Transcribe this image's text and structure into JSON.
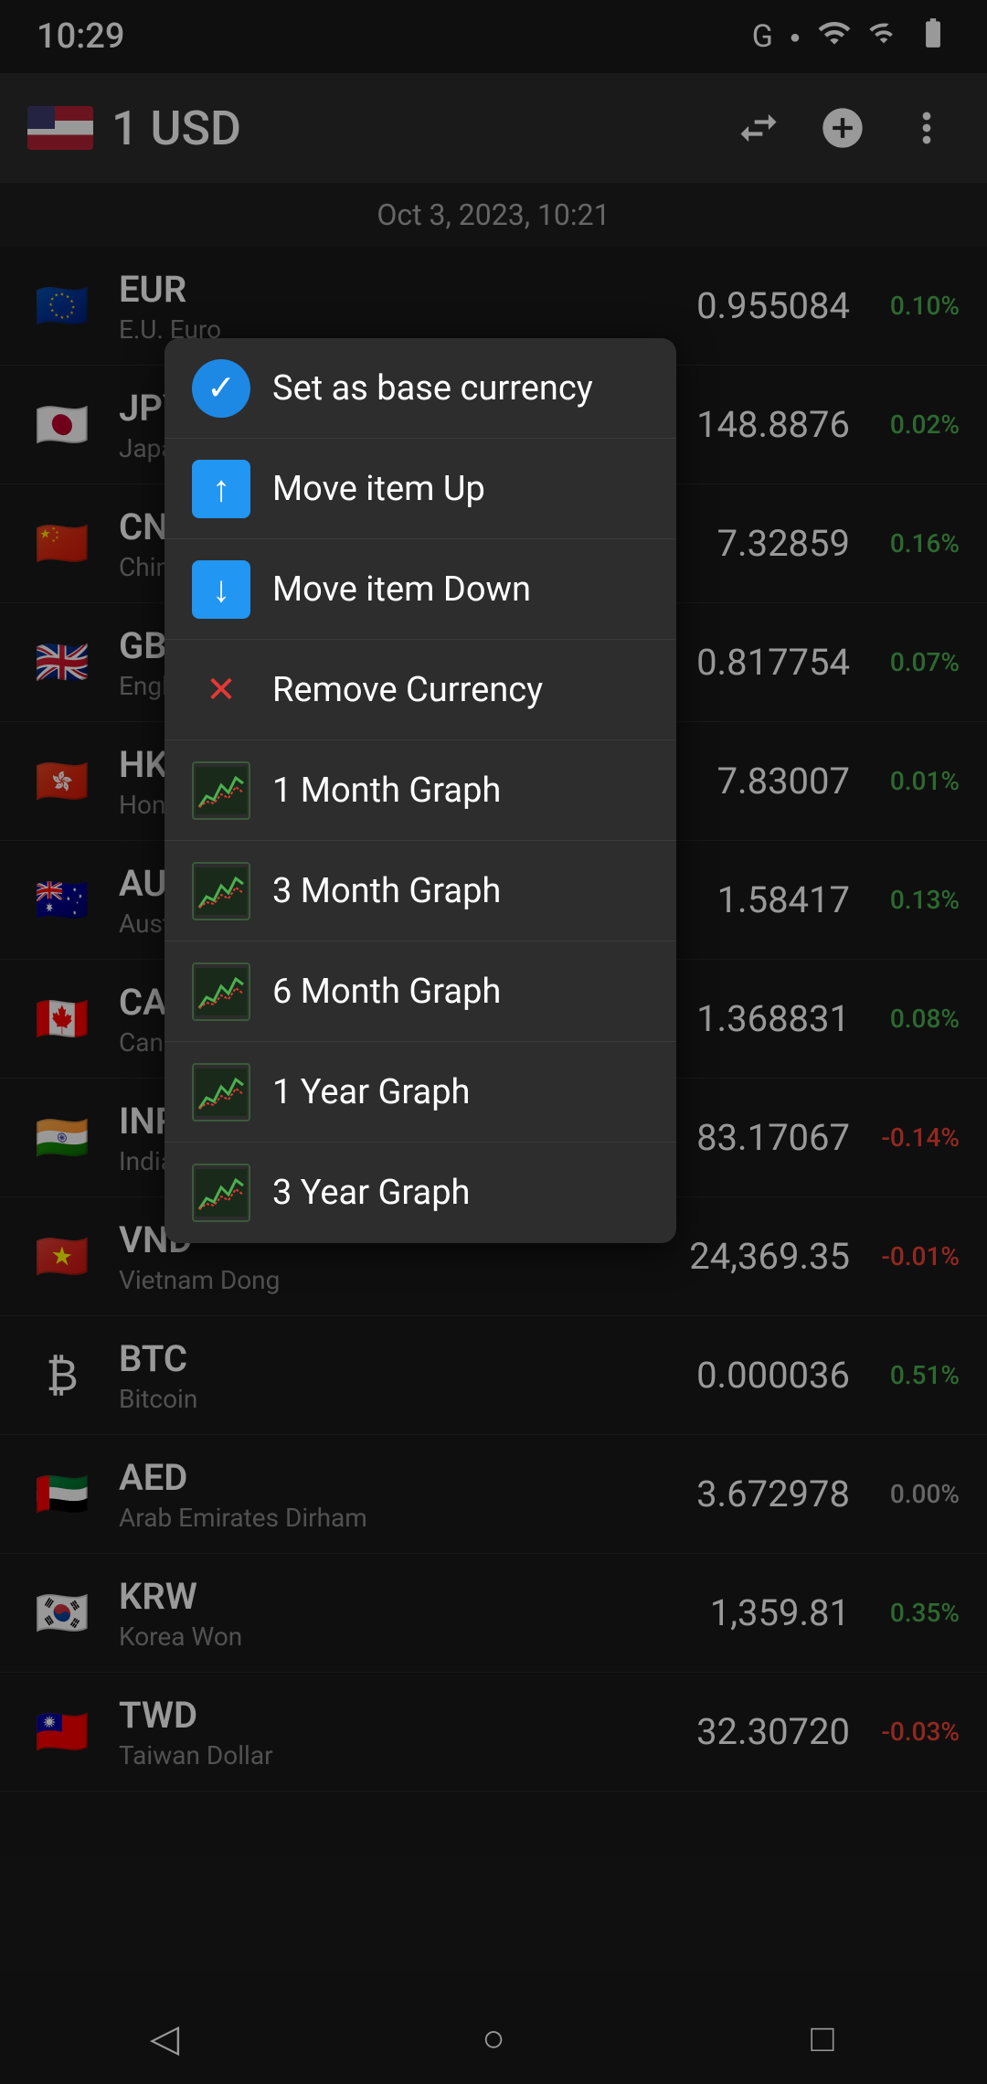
{
  "statusBar": {
    "time": "10:29",
    "icons": [
      "G",
      "signal",
      "wifi",
      "battery"
    ]
  },
  "toolbar": {
    "baseCurrency": "1 USD",
    "convertBtn": "→",
    "addBtn": "+",
    "moreBtn": "⋮"
  },
  "dateBar": {
    "text": "Oct 3, 2023, 10:21"
  },
  "currencies": [
    {
      "code": "EUR",
      "name": "E.U. Euro",
      "value": "0.955084",
      "change": "0.10%",
      "positive": true,
      "flag": "🇪🇺"
    },
    {
      "code": "JPY",
      "name": "Japanese Yen",
      "value": "148.8876",
      "change": "0.02%",
      "positive": true,
      "flag": "🇯🇵"
    },
    {
      "code": "CNY",
      "name": "Chinese Yuan",
      "value": "7.32859",
      "change": "0.16%",
      "positive": true,
      "flag": "🇨🇳"
    },
    {
      "code": "GBP",
      "name": "England Pound",
      "value": "0.817754",
      "change": "0.07%",
      "positive": true,
      "flag": "🇬🇧"
    },
    {
      "code": "HKD",
      "name": "Hong Kong Dollar",
      "value": "7.83007",
      "change": "0.01%",
      "positive": true,
      "flag": "🇭🇰"
    },
    {
      "code": "AUD",
      "name": "Australian Dollar",
      "value": "1.58417",
      "change": "0.13%",
      "positive": true,
      "flag": "🇦🇺"
    },
    {
      "code": "CAD",
      "name": "Canadian Dollar",
      "value": "1.368831",
      "change": "0.08%",
      "positive": true,
      "flag": "🇨🇦"
    },
    {
      "code": "INR",
      "name": "Indian Rupee",
      "value": "83.17067",
      "change": "-0.14%",
      "positive": false,
      "flag": "🇮🇳"
    },
    {
      "code": "VND",
      "name": "Vietnam Dong",
      "value": "24,369.35",
      "change": "-0.01%",
      "positive": false,
      "flag": "🇻🇳"
    },
    {
      "code": "BTC",
      "name": "Bitcoin",
      "value": "0.000036",
      "change": "0.51%",
      "positive": true,
      "flag": "₿"
    },
    {
      "code": "AED",
      "name": "Arab Emirates Dirham",
      "value": "3.672978",
      "change": "0.00%",
      "positive": null,
      "flag": "🇦🇪"
    },
    {
      "code": "KRW",
      "name": "Korea Won",
      "value": "1,359.81",
      "change": "0.35%",
      "positive": true,
      "flag": "🇰🇷"
    },
    {
      "code": "TWD",
      "name": "Taiwan Dollar",
      "value": "32.30720",
      "change": "-0.03%",
      "positive": false,
      "flag": "🇹🇼"
    }
  ],
  "contextMenu": {
    "items": [
      {
        "id": "set-base",
        "label": "Set as base currency",
        "icon": "✓",
        "iconType": "check"
      },
      {
        "id": "move-up",
        "label": "Move item Up",
        "icon": "↑",
        "iconType": "up"
      },
      {
        "id": "move-down",
        "label": "Move item Down",
        "icon": "↓",
        "iconType": "down"
      },
      {
        "id": "remove",
        "label": "Remove Currency",
        "icon": "✕",
        "iconType": "remove"
      },
      {
        "id": "1month",
        "label": "1 Month Graph",
        "icon": "graph",
        "iconType": "graph"
      },
      {
        "id": "3month",
        "label": "3 Month Graph",
        "icon": "graph",
        "iconType": "graph"
      },
      {
        "id": "6month",
        "label": "6 Month Graph",
        "icon": "graph",
        "iconType": "graph"
      },
      {
        "id": "1year",
        "label": "1 Year Graph",
        "icon": "graph",
        "iconType": "graph"
      },
      {
        "id": "3year",
        "label": "3 Year Graph",
        "icon": "graph",
        "iconType": "graph"
      }
    ]
  },
  "navBar": {
    "backBtn": "◁",
    "homeBtn": "○",
    "recentBtn": "□"
  }
}
